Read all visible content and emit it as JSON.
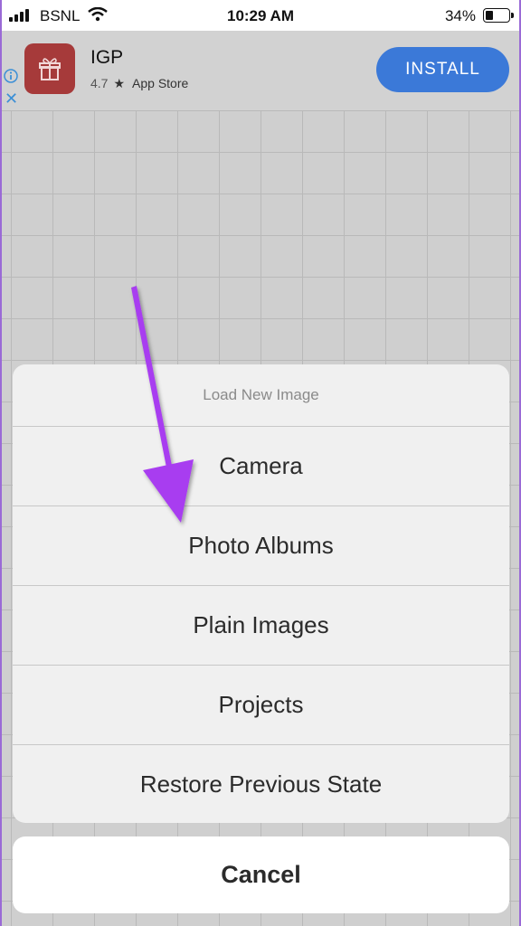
{
  "status_bar": {
    "carrier": "BSNL",
    "time": "10:29 AM",
    "battery_percent": "34%",
    "battery_level": 0.34,
    "icons": [
      "signal-icon",
      "wifi-icon",
      "battery-icon"
    ]
  },
  "ad": {
    "app_name": "IGP",
    "rating": "4.7",
    "rating_icon": "star-icon",
    "store": "App Store",
    "install_label": "INSTALL",
    "app_icon": "gift-icon",
    "info_icon": "info-icon",
    "close_icon": "close-icon",
    "colors": {
      "install_button": "#3b79d8",
      "app_icon_bg": "#a63a3a"
    }
  },
  "action_sheet": {
    "title": "Load New Image",
    "options": [
      {
        "label": "Camera"
      },
      {
        "label": "Photo Albums"
      },
      {
        "label": "Plain Images"
      },
      {
        "label": "Projects"
      },
      {
        "label": "Restore Previous State"
      }
    ],
    "cancel_label": "Cancel"
  },
  "annotation": {
    "arrow_color": "#a83df0",
    "points_to": "Photo Albums"
  }
}
